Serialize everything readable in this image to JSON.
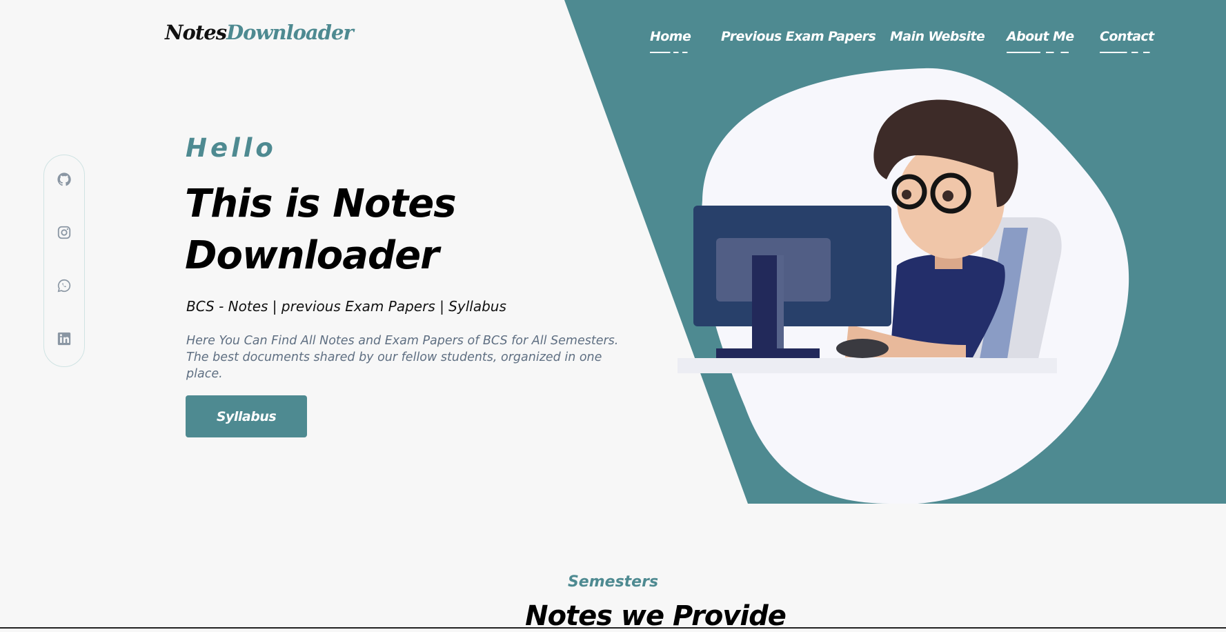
{
  "brand": {
    "part1": "Notes",
    "part2": "Downloader"
  },
  "nav": {
    "items": [
      {
        "label": "Home"
      },
      {
        "label": "Previous Exam Papers"
      },
      {
        "label": "Main Website"
      },
      {
        "label": "About Me"
      },
      {
        "label": "Contact"
      }
    ]
  },
  "social": {
    "icons": [
      "github-icon",
      "instagram-icon",
      "whatsapp-icon",
      "linkedin-icon"
    ]
  },
  "hero": {
    "greeting": "Hello",
    "title_line1": "This is Notes",
    "title_line2": "Downloader",
    "subtitle": "BCS - Notes | previous Exam Papers | Syllabus",
    "description": "Here You Can Find All Notes and Exam Papers of BCS for All Semesters. The best documents shared by our fellow students, organized in one place.",
    "cta_label": "Syllabus"
  },
  "section": {
    "label": "Semesters",
    "title": "Notes we Provide"
  },
  "colors": {
    "accent": "#4e8a91",
    "background": "#f7f7f7",
    "muted_text": "#5f6f82"
  }
}
